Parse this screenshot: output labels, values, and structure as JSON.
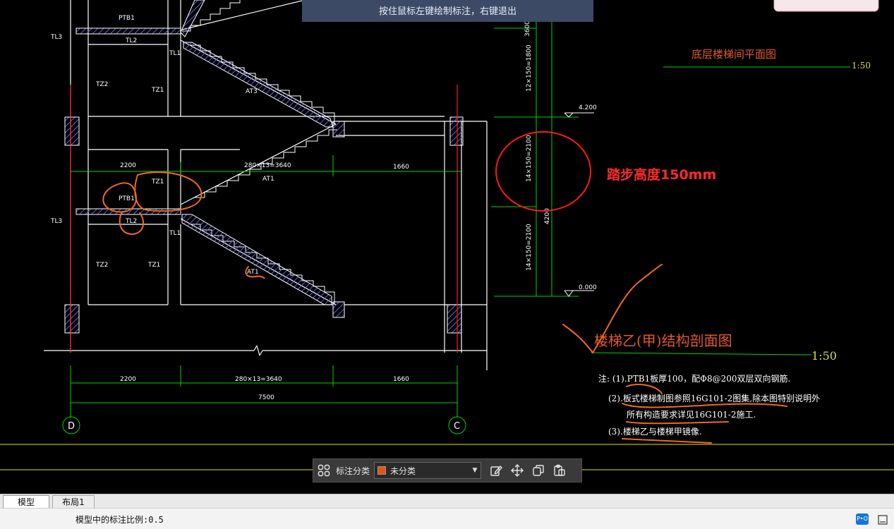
{
  "hint": "按住鼠标左键绘制标注，右键退出",
  "drawing": {
    "labels": {
      "ptb1_top": "PTB1",
      "tl2_top": "TL2",
      "tl3_top": "TL3",
      "tl1_top": "TL1",
      "tz2_top": "TZ2",
      "tz1_top": "TZ1",
      "at3": "AT3",
      "dim_2200_mid": "2200",
      "dim_280_mid": "280×13=3640",
      "dim_1660_mid": "1660",
      "tz1_mid": "TZ1",
      "ptb1_mid": "PTB1",
      "at1_mid": "AT1",
      "tl3_mid": "TL3",
      "tl2_mid": "TL2",
      "tl1_mid": "TL1",
      "tz2_bot": "TZ2",
      "tz1_bot": "TZ1",
      "at1_bot": "AT1",
      "dim_2200_bot": "2200",
      "dim_280_bot": "280×13=3640",
      "dim_1660_bot": "1660",
      "dim_7500": "7500",
      "axis_d": "D",
      "axis_c": "C",
      "vdim_3600": "3600",
      "vdim_12x150": "12×150=1800",
      "vdim_14x150_a": "14×150=2100",
      "vdim_4200": "4200",
      "vdim_14x150_b": "14×150=2100",
      "elev_4200": "4.200",
      "elev_0000": "0.000",
      "plan_title": "底层楼梯间平面图",
      "plan_scale": "1:50",
      "section_title": "楼梯乙(甲)结构剖面图",
      "section_scale": "1:50",
      "note1": "注: (1).PTB1板厚100，配Φ8@200双层双向钢筋.",
      "note2": "(2).板式楼梯制图参照16G101-2图集,除本图特别说明外",
      "note3": "所有构造要求详见16G101-2施工.",
      "note4": "(3).楼梯乙与楼梯甲镜像.",
      "annotation": "踏步高度150mm"
    }
  },
  "toolbar": {
    "grid_icon": "grid-icon",
    "label": "标注分类",
    "selected": "未分类",
    "swatch_color": "#e8540e",
    "edit_icon": "edit-icon",
    "move_icon": "move-icon",
    "copy_icon": "copy-icon",
    "paste_icon": "paste-icon"
  },
  "tabs": [
    "模型",
    "布局1"
  ],
  "status": {
    "text": "模型中的标注比例:0.5",
    "btn1": "P•O"
  },
  "colors": {
    "white": "#ffffff",
    "green": "#00d400",
    "yellow": "#e6e600",
    "red": "#ff1a1a",
    "orange": "#ef6a1c",
    "hatch": "#5f5fd0",
    "olive": "#d8d84a"
  }
}
